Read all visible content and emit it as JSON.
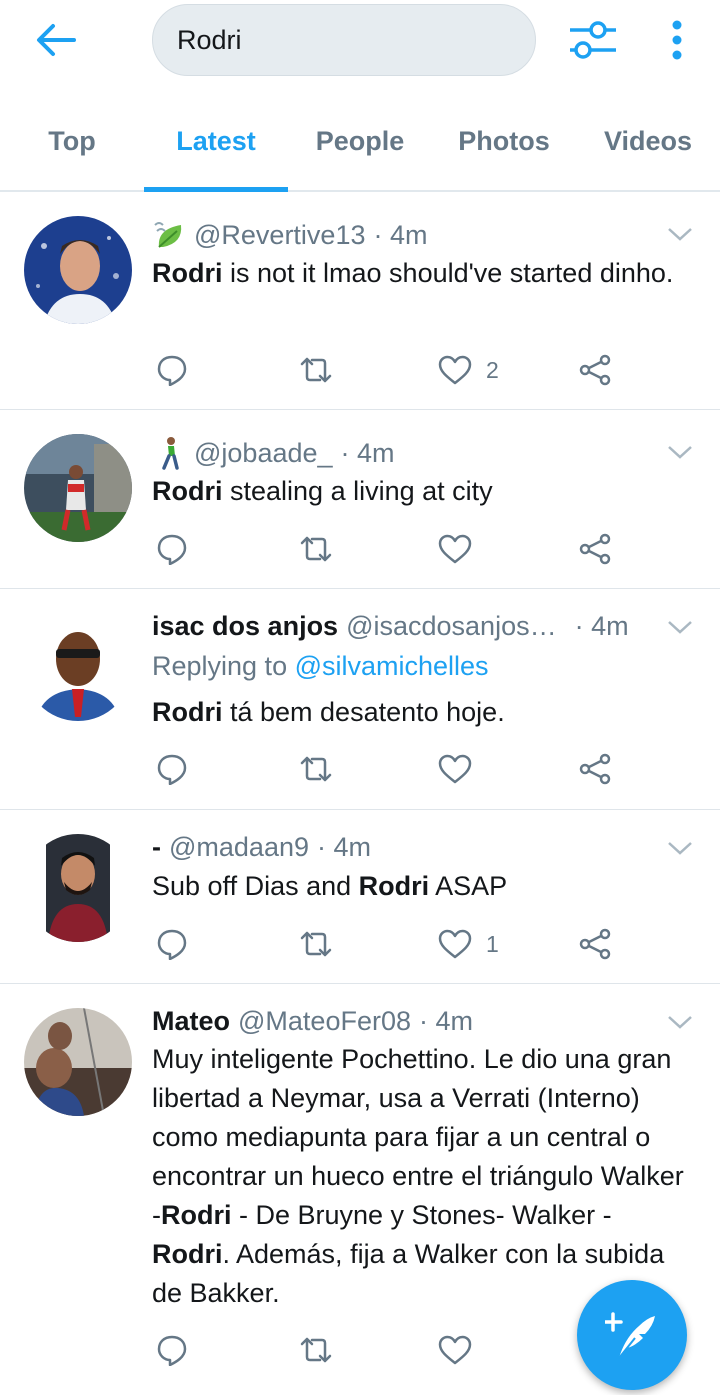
{
  "search": {
    "query": "Rodri"
  },
  "tabs": [
    {
      "label": "Top"
    },
    {
      "label": "Latest"
    },
    {
      "label": "People"
    },
    {
      "label": "Photos"
    },
    {
      "label": "Videos"
    }
  ],
  "active_tab": "Latest",
  "tweets": [
    {
      "display_name": "",
      "name_emoji": "leaf-wind-emoji",
      "handle": "@Revertive13",
      "time": "· 4m",
      "text_bold_1": "Rodri",
      "text_1": " is not it lmao should've started dinho.",
      "like_count": "2"
    },
    {
      "display_name": "",
      "name_emoji": "person-walking-emoji",
      "handle": "@jobaade_",
      "time": "· 4m",
      "text_bold_1": "Rodri",
      "text_1": " stealing a living at city",
      "like_count": ""
    },
    {
      "display_name": "isac dos anjos",
      "handle": "@isacdosanjos…",
      "time": "· 4m",
      "replying_label": "Replying to ",
      "replying_handle": "@silvamichelles",
      "text_bold_1": "Rodri",
      "text_1": " tá bem desatento hoje.",
      "like_count": ""
    },
    {
      "display_name": "-",
      "handle": "@madaan9",
      "time": "· 4m",
      "text_0": "Sub off Dias and ",
      "text_bold_1": "Rodri",
      "text_1": " ASAP",
      "like_count": "1"
    },
    {
      "display_name": "Mateo",
      "handle": "@MateoFer08",
      "time": "· 4m",
      "text_0": "Muy inteligente Pochettino. Le dio una gran libertad a Neymar, usa a Verrati (Interno) como mediapunta para fijar a un central o encontrar un hueco entre el triángulo Walker -",
      "text_bold_1": "Rodri",
      "text_1": " - De Bruyne y Stones- Walker - ",
      "text_bold_2": "Rodri",
      "text_2": ". Además, fija a Walker con la subida de Bakker.",
      "like_count": ""
    }
  ],
  "icons": {
    "back": "arrow-left-icon",
    "filter": "sliders-icon",
    "more": "vertical-dots-icon",
    "reply": "speech-bubble-icon",
    "retweet": "retweet-icon",
    "like": "heart-icon",
    "share": "share-icon",
    "compose": "feather-plus-icon"
  },
  "colors": {
    "accent": "#1da1f2",
    "muted": "#657786",
    "text": "#14171a"
  }
}
